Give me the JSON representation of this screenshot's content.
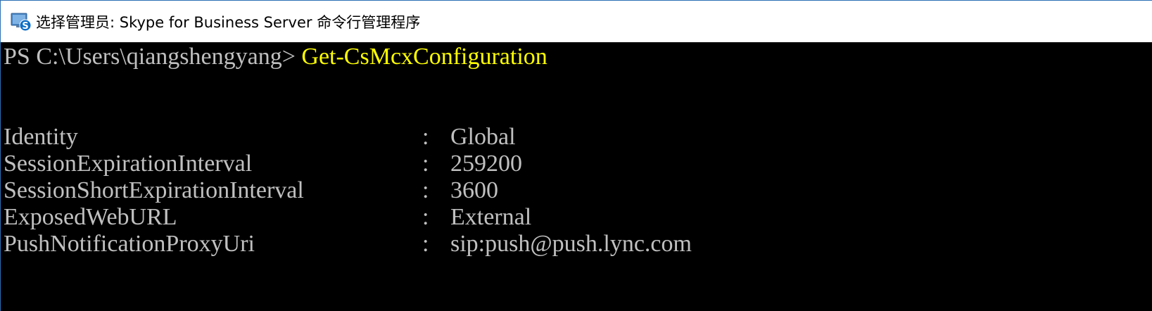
{
  "window": {
    "title": "选择管理员: Skype for Business Server 命令行管理程序",
    "icon": "skype-for-business-icon"
  },
  "console": {
    "prompt": "PS C:\\Users\\qiangshengyang> ",
    "command": "Get-CsMcxConfiguration",
    "separator": ":",
    "rows": [
      {
        "key": "Identity",
        "value": "Global"
      },
      {
        "key": "SessionExpirationInterval",
        "value": "259200"
      },
      {
        "key": "SessionShortExpirationInterval",
        "value": "3600"
      },
      {
        "key": "ExposedWebURL",
        "value": "External"
      },
      {
        "key": "PushNotificationProxyUri",
        "value": "sip:push@push.lync.com"
      }
    ]
  },
  "colors": {
    "background": "#000000",
    "text": "#c0c0c0",
    "command": "#ffff00"
  }
}
